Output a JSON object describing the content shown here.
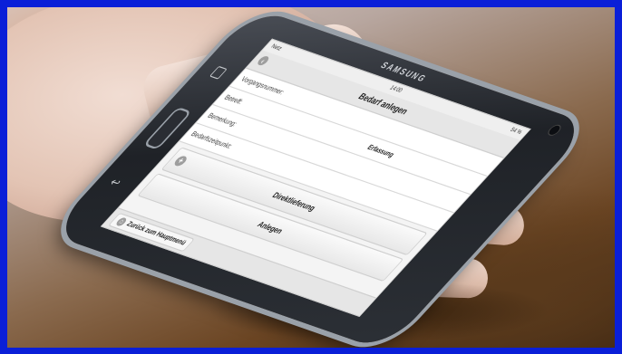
{
  "phone": {
    "brand": "SAMSUNG"
  },
  "status_bar": {
    "left": "Netz",
    "time": "14:00",
    "right": "54 %"
  },
  "app": {
    "title": "Bedarf anlegen",
    "fields": [
      {
        "label": "Vorgangsnummer:",
        "value": ""
      },
      {
        "label": "Betreff:",
        "value": "Erfassung"
      },
      {
        "label": "Bemerkung:",
        "value": ""
      },
      {
        "label": "Bedarfszeitpunkt:",
        "value": ""
      }
    ],
    "buttons": {
      "direct_delivery": "Direktlieferung",
      "create": "Anlegen"
    },
    "footer": {
      "home_link": "Zurück zum Hauptmenü"
    }
  },
  "colors": {
    "frame": "#0a1fd8",
    "screen_bg": "#f4f4f4",
    "bar_bg": "#e6e6e6"
  }
}
